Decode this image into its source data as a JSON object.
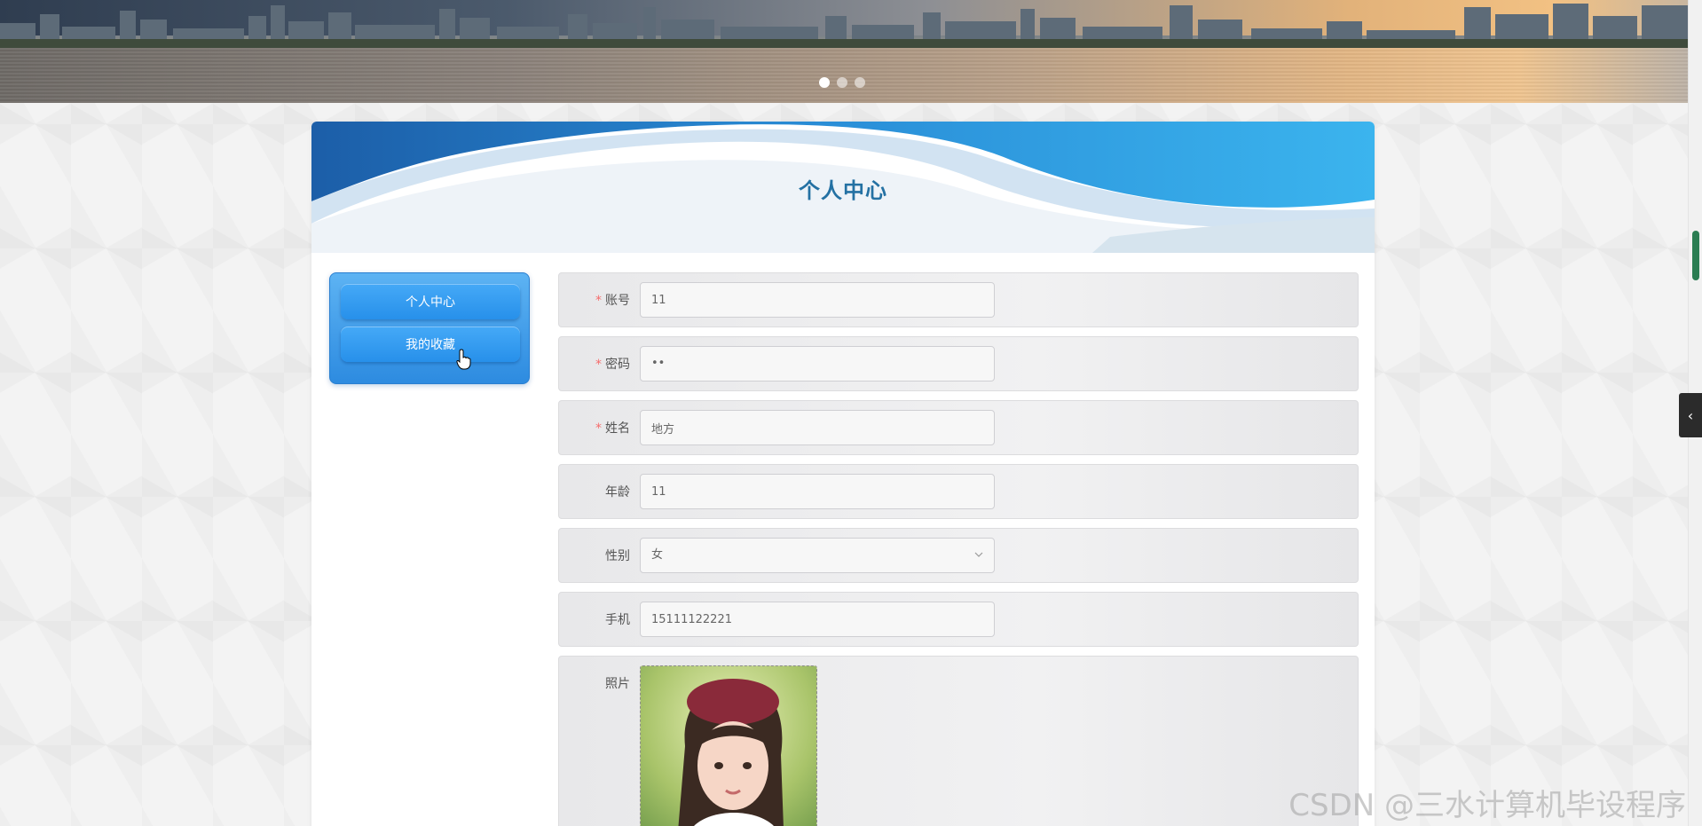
{
  "banner": {
    "slides": 3,
    "active_slide": 1
  },
  "header": {
    "title": "个人中心"
  },
  "side_menu": {
    "items": [
      {
        "label": "个人中心"
      },
      {
        "label": "我的收藏"
      }
    ]
  },
  "form": {
    "account": {
      "label": "账号",
      "value": "11",
      "required": true
    },
    "password": {
      "label": "密码",
      "value": "••",
      "required": true
    },
    "name": {
      "label": "姓名",
      "value": "地方",
      "required": true
    },
    "age": {
      "label": "年龄",
      "value": "11",
      "required": false
    },
    "gender": {
      "label": "性别",
      "value": "女",
      "required": false
    },
    "phone": {
      "label": "手机",
      "value": "15111122221",
      "required": false
    },
    "photo": {
      "label": "照片"
    }
  },
  "watermark": "CSDN @三水计算机毕设程序",
  "colors": {
    "title": "#2471a3",
    "menu_blue": "#2d8be0",
    "required": "#f56c6c"
  }
}
